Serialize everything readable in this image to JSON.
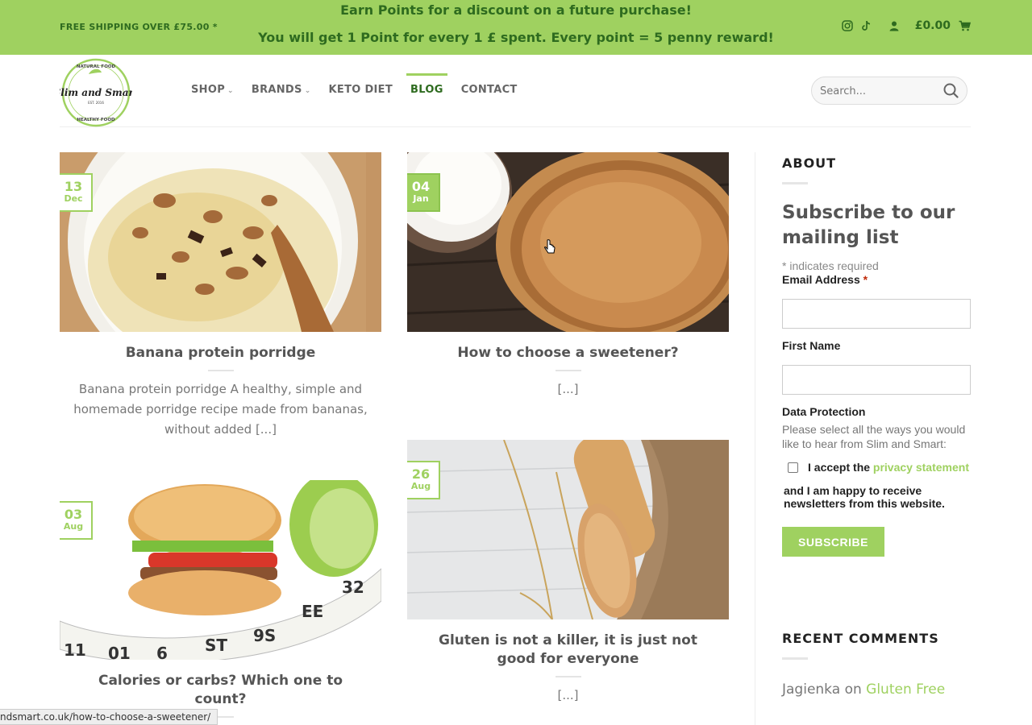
{
  "topbar": {
    "shipping": "FREE SHIPPING OVER £75.00 *",
    "promo_line1": "Earn Points for a discount on a future purchase!",
    "promo_line2": "You will get 1 Point for every 1 £ spent. Every point = 5 penny reward!",
    "cart_total": "£0.00",
    "icons": [
      "instagram-icon",
      "tiktok-icon",
      "user-icon",
      "cart-icon"
    ]
  },
  "logo": {
    "top_text": "NATURAL FOOD",
    "script": "Slim and Smart",
    "est": "EST. 2016",
    "bottom_text": "HEALTHY FOOD"
  },
  "nav": [
    {
      "label": "SHOP",
      "dropdown": true
    },
    {
      "label": "BRANDS",
      "dropdown": true
    },
    {
      "label": "KETO DIET",
      "dropdown": false
    },
    {
      "label": "BLOG",
      "dropdown": false,
      "active": true
    },
    {
      "label": "CONTACT",
      "dropdown": false
    }
  ],
  "search": {
    "placeholder": "Search..."
  },
  "posts": [
    {
      "day": "13",
      "month": "Dec",
      "title": "Banana protein porridge",
      "excerpt": "Banana protein porridge A healthy, simple and homemade porridge recipe made from bananas, without added [...]"
    },
    {
      "day": "04",
      "month": "Jan",
      "title": "How to choose a sweetener?",
      "excerpt": "[...]"
    },
    {
      "day": "03",
      "month": "Aug",
      "title": "Calories or carbs? Which one to count?",
      "excerpt": "[...]"
    },
    {
      "day": "26",
      "month": "Aug",
      "title": "Gluten is not a killer, it is just not good for everyone",
      "excerpt": "[...]"
    }
  ],
  "sidebar": {
    "about_title": "ABOUT",
    "subscribe_heading": "Subscribe to our mailing list",
    "required_note": "* indicates required",
    "email_label": "Email Address",
    "required_star": "*",
    "first_name_label": "First Name",
    "data_protection_label": "Data Protection",
    "data_protection_text": "Please select all the ways you would like to hear from Slim and Smart:",
    "accept_prefix": "I accept the",
    "privacy_link": "privacy statement",
    "newsletter_text": "and I am happy to receive newsletters from this website.",
    "subscribe_button": "SUBSCRIBE",
    "recent_comments_title": "RECENT COMMENTS",
    "recent_comment_author": "Jagienka",
    "recent_comment_on": "on",
    "recent_comment_link": "Gluten Free"
  },
  "statusbar": {
    "url": "ndsmart.co.uk/how-to-choose-a-sweetener/"
  },
  "colors": {
    "accent": "#9fd160",
    "accent_dark": "#2e6b1f"
  }
}
